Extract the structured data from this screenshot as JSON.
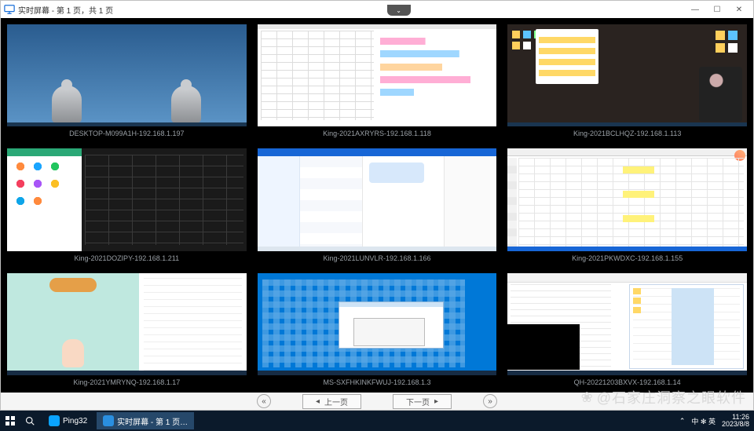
{
  "window": {
    "title": "实时屏幕 - 第 1 页，共 1 页",
    "min_tip": "—",
    "max_tip": "☐",
    "close_tip": "✕",
    "dropdown_glyph": "⌄"
  },
  "screens": [
    {
      "label": "DESKTOP-M099A1H-192.168.1.197"
    },
    {
      "label": "King-2021AXRYRS-192.168.1.118"
    },
    {
      "label": "King-2021BCLHQZ-192.168.1.113"
    },
    {
      "label": "King-2021DOZIPY-192.168.1.211"
    },
    {
      "label": "King-2021LUNVLR-192.168.1.166"
    },
    {
      "label": "King-2021PKWDXC-192.168.1.155"
    },
    {
      "label": "King-2021YMRYNQ-192.168.1.17"
    },
    {
      "label": "MS-SXFHKINKFWUJ-192.168.1.3"
    },
    {
      "label": "QH-20221203BXVX-192.168.1.14"
    }
  ],
  "pager": {
    "prev": "上一页",
    "next": "下一页",
    "first_glyph": "«",
    "last_glyph": "»"
  },
  "taskbar": {
    "app1_name": "Ping32",
    "app2_name": "实时屏幕 - 第 1 页…"
  },
  "tray": {
    "ime": "中 ✻ 英",
    "net_glyph": "⌃",
    "time": "11:26",
    "date": "2023/8/8"
  },
  "watermark": {
    "text": "@石家庄洞察之眼软件",
    "flower": "❀"
  }
}
